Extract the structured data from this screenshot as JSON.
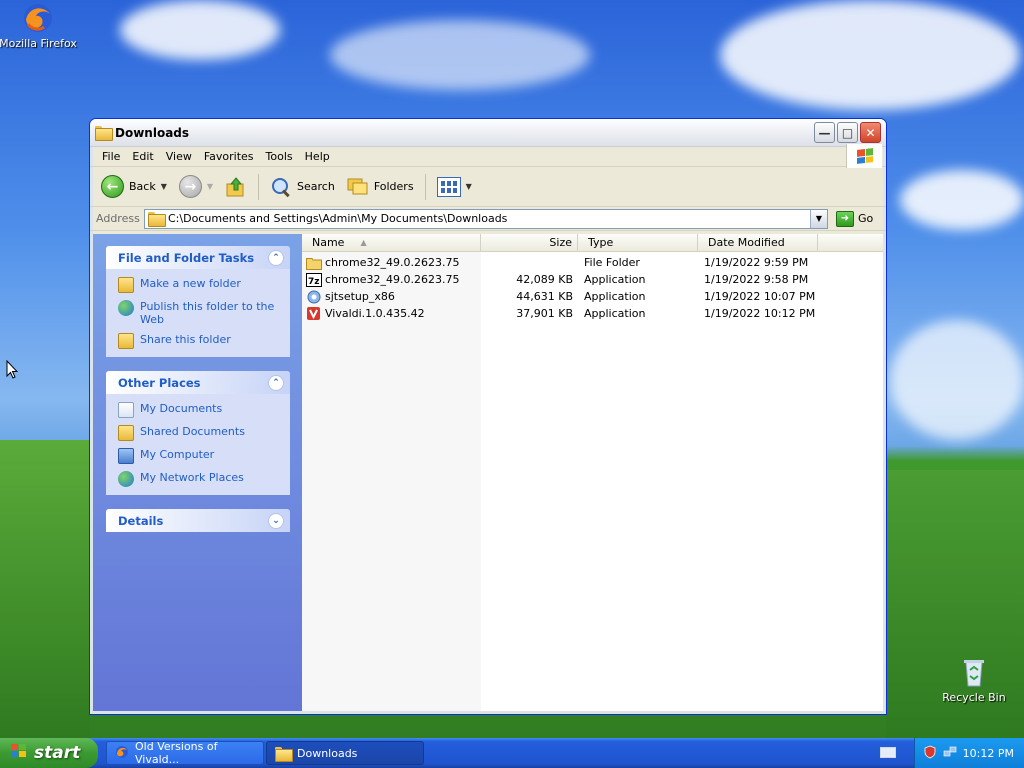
{
  "desktop": {
    "icons": [
      {
        "label": "Mozilla Firefox"
      },
      {
        "label": "Recycle Bin"
      }
    ]
  },
  "window": {
    "title": "Downloads",
    "menu": [
      "File",
      "Edit",
      "View",
      "Favorites",
      "Tools",
      "Help"
    ],
    "toolbar": {
      "back": "Back",
      "search": "Search",
      "folders": "Folders"
    },
    "address": {
      "label": "Address",
      "value": "C:\\Documents and Settings\\Admin\\My Documents\\Downloads",
      "go": "Go"
    },
    "taskpane": {
      "file_tasks": {
        "title": "File and Folder Tasks",
        "items": [
          "Make a new folder",
          "Publish this folder to the\nWeb",
          "Share this folder"
        ]
      },
      "other_places": {
        "title": "Other Places",
        "items": [
          "My Documents",
          "Shared Documents",
          "My Computer",
          "My Network Places"
        ]
      },
      "details": {
        "title": "Details"
      }
    },
    "columns": [
      "Name",
      "Size",
      "Type",
      "Date Modified"
    ],
    "files": [
      {
        "name": "chrome32_49.0.2623.75",
        "size": "",
        "type": "File Folder",
        "date": "1/19/2022 9:59 PM",
        "icon": "folder-icon"
      },
      {
        "name": "chrome32_49.0.2623.75",
        "size": "42,089 KB",
        "type": "Application",
        "date": "1/19/2022 9:58 PM",
        "icon": "7zip-icon"
      },
      {
        "name": "sjtsetup_x86",
        "size": "44,631 KB",
        "type": "Application",
        "date": "1/19/2022 10:07 PM",
        "icon": "setup-icon"
      },
      {
        "name": "Vivaldi.1.0.435.42",
        "size": "37,901 KB",
        "type": "Application",
        "date": "1/19/2022 10:12 PM",
        "icon": "vivaldi-icon"
      }
    ]
  },
  "taskbar": {
    "start": "start",
    "tasks": [
      "Old Versions of Vivald...",
      "Downloads"
    ],
    "clock": "10:12 PM"
  },
  "colors": {
    "title_active": "#215dc6",
    "taskbar": "#245edb",
    "start": "#3c9a32"
  }
}
